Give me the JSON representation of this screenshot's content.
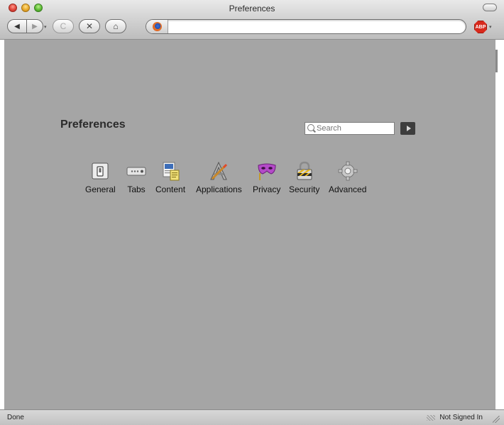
{
  "window": {
    "title": "Preferences"
  },
  "toolbar": {
    "back_label": "◀",
    "forward_label": "▶",
    "reload_label": "C",
    "stop_label": "✕",
    "home_label": "⌂",
    "url_value": "",
    "abp_label": "ABP",
    "dropdown_arrow": "▾"
  },
  "prefs": {
    "title": "Preferences",
    "search_placeholder": "Search",
    "panes": [
      {
        "label": "General",
        "icon": "switch-icon"
      },
      {
        "label": "Tabs",
        "icon": "tabs-icon"
      },
      {
        "label": "Content",
        "icon": "content-icon"
      },
      {
        "label": "Applications",
        "icon": "applications-icon"
      },
      {
        "label": "Privacy",
        "icon": "mask-icon"
      },
      {
        "label": "Security",
        "icon": "lock-icon"
      },
      {
        "label": "Advanced",
        "icon": "gear-icon"
      }
    ]
  },
  "status": {
    "left": "Done",
    "right": "Not Signed In"
  },
  "colors": {
    "content_bg": "#a5a5a5",
    "abp_red": "#d8291c"
  }
}
